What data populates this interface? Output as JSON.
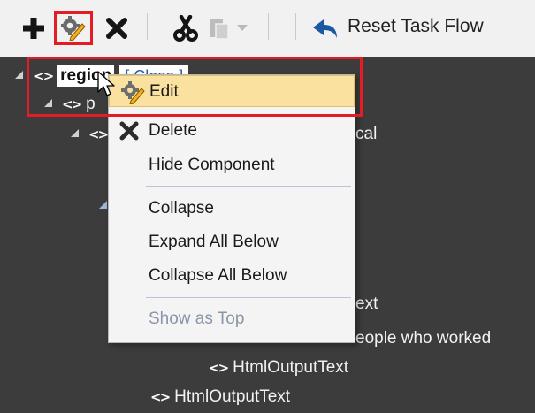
{
  "toolbar": {
    "reset_label": "Reset Task Flow",
    "highlight_color": "#e41c24",
    "icons": [
      "add-icon",
      "edit-icon",
      "delete-icon",
      "cut-icon",
      "paste-icon",
      "dropdown-icon",
      "undo-icon"
    ]
  },
  "tree": {
    "region_label": "region",
    "close_label": "[ Close ]",
    "child_fragment": "p",
    "row3_tail": "cal",
    "row_ext": "ext",
    "row_people": "eople who worked",
    "html_output_1": "HtmlOutputText",
    "html_output_2": "HtmlOutputText"
  },
  "context_menu": {
    "items": [
      {
        "label": "Edit",
        "icon": "edit-icon",
        "highlighted": true
      },
      {
        "label": "Delete",
        "icon": "delete-icon"
      },
      {
        "label": "Hide Component"
      },
      {
        "label": "Collapse"
      },
      {
        "label": "Expand All Below"
      },
      {
        "label": "Collapse All Below"
      },
      {
        "label": "Show as Top",
        "disabled": true
      }
    ],
    "highlight_color": "#fbe19f"
  }
}
